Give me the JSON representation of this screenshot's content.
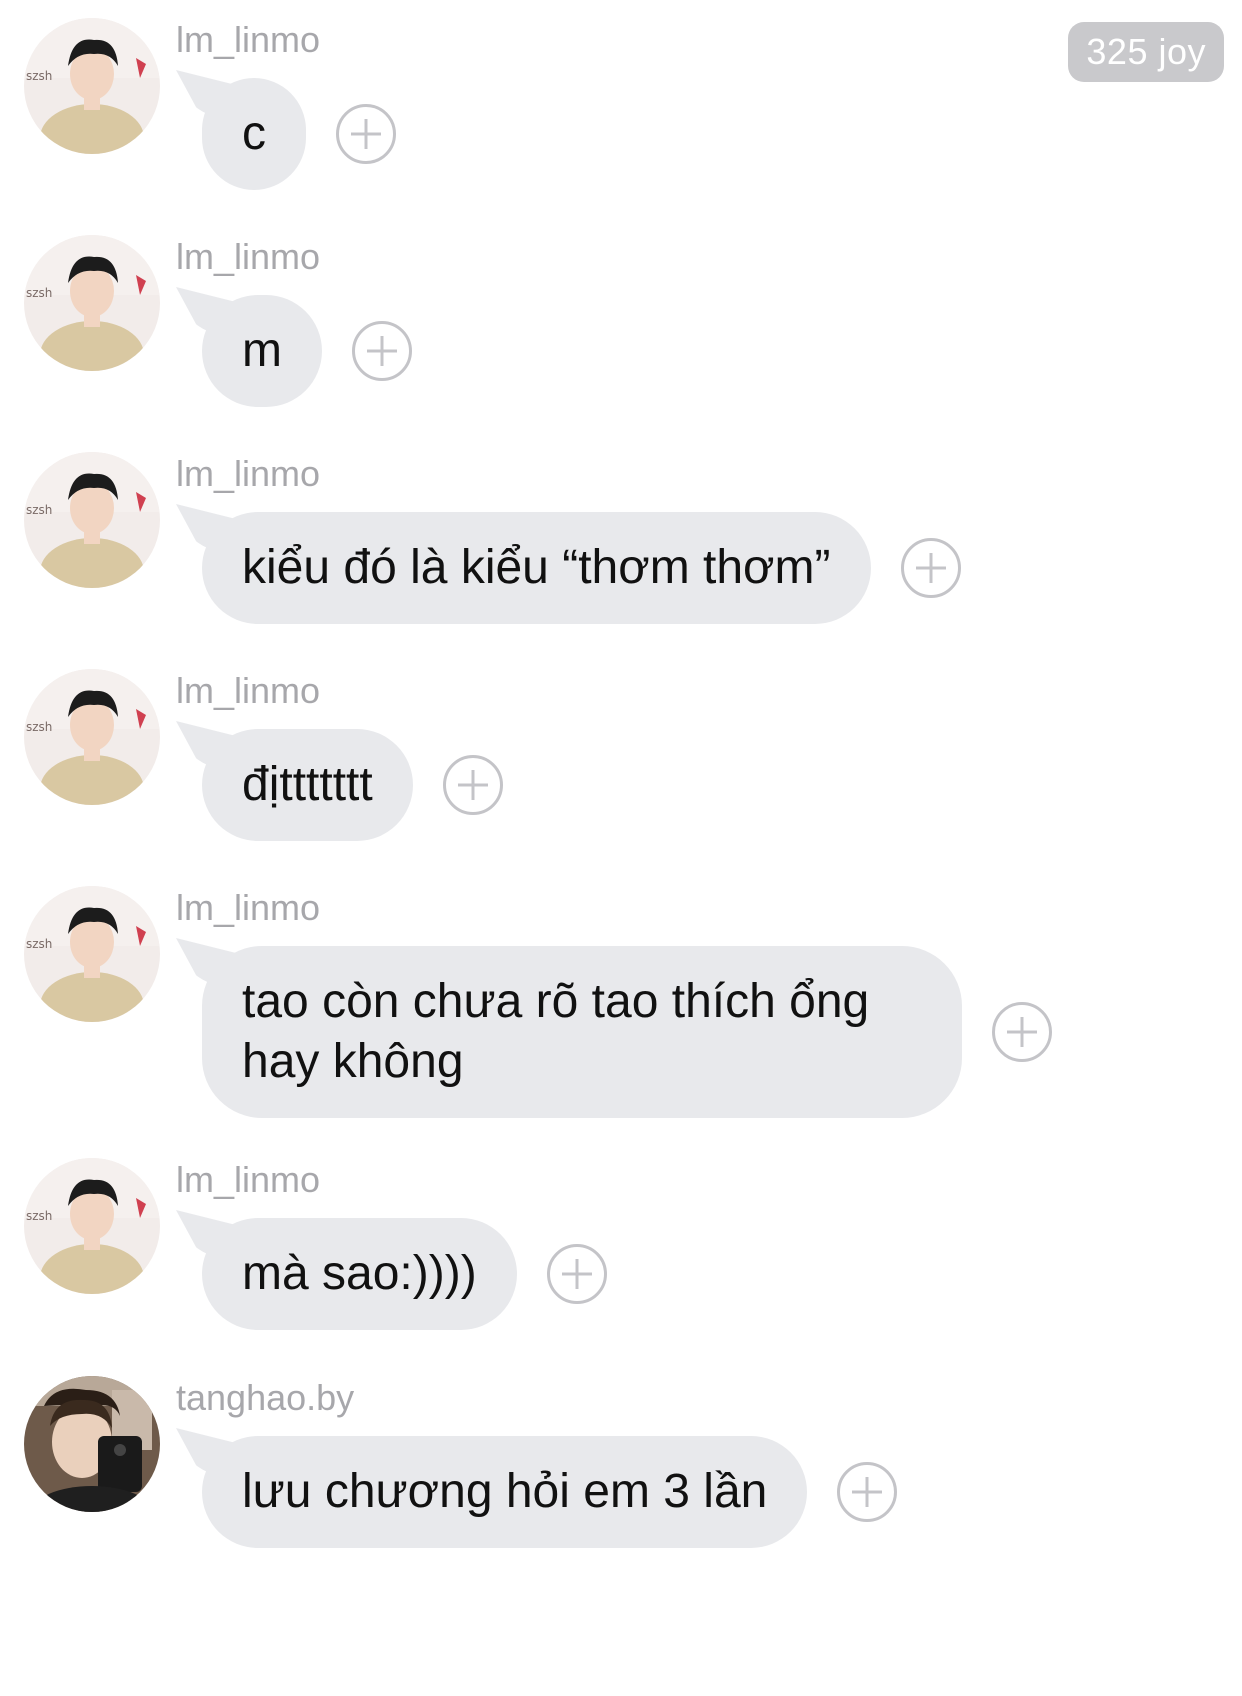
{
  "header": {
    "joy_badge": "325 joy"
  },
  "messages": [
    {
      "user": "lm_linmo",
      "avatar_icon": "user-avatar-lm_linmo-icon",
      "text": "c"
    },
    {
      "user": "lm_linmo",
      "avatar_icon": "user-avatar-lm_linmo-icon",
      "text": "m"
    },
    {
      "user": "lm_linmo",
      "avatar_icon": "user-avatar-lm_linmo-icon",
      "text": "kiểu đó là kiểu “thơm thơm”"
    },
    {
      "user": "lm_linmo",
      "avatar_icon": "user-avatar-lm_linmo-icon",
      "text": "địttttttt"
    },
    {
      "user": "lm_linmo",
      "avatar_icon": "user-avatar-lm_linmo-icon",
      "text": "tao còn chưa rõ tao thích ổng hay không"
    },
    {
      "user": "lm_linmo",
      "avatar_icon": "user-avatar-lm_linmo-icon",
      "text": "mà sao:))))"
    },
    {
      "user": "tanghao.by",
      "avatar_icon": "user-avatar-tanghao-icon",
      "text": "lưu chương hỏi em 3 lần"
    }
  ],
  "colors": {
    "bubble_bg": "#e8e9ec",
    "username_text": "#a7a7ab",
    "badge_bg": "#c9c9cc",
    "plus_icon": "#c4c4c8"
  }
}
